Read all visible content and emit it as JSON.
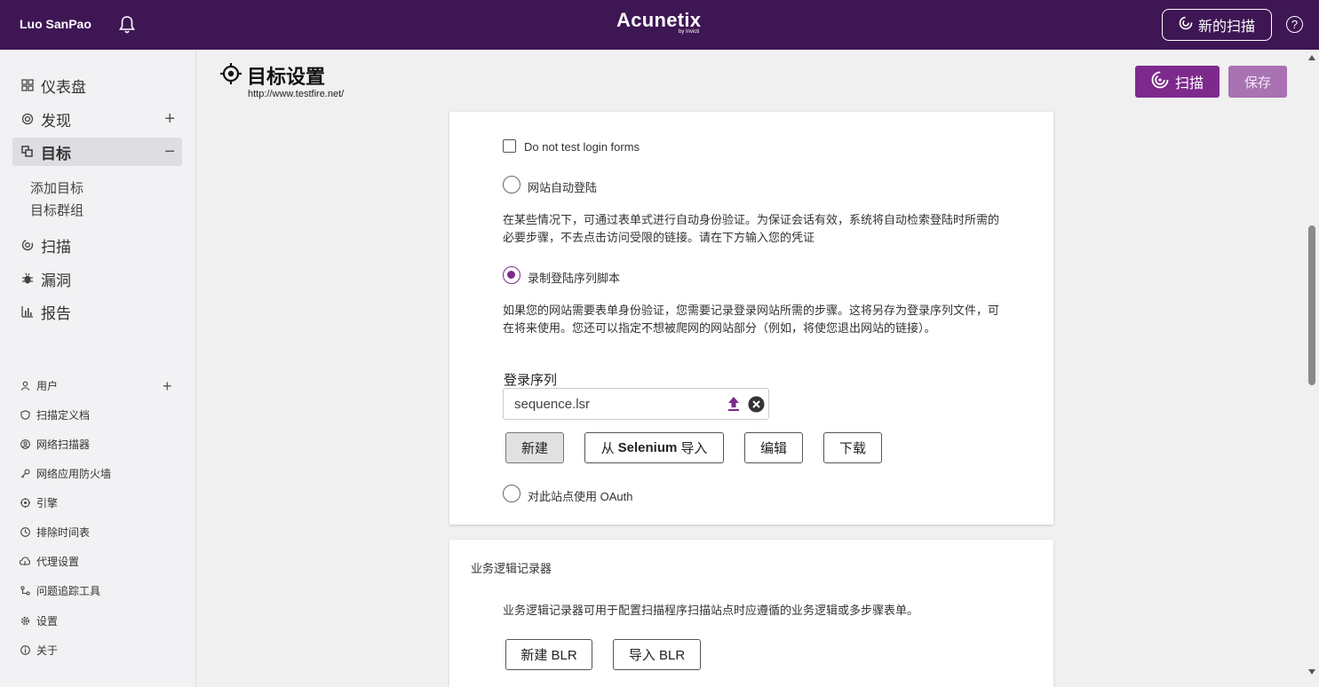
{
  "topbar": {
    "user_name": "Luo SanPao",
    "brand_name": "Acunetix",
    "brand_by": "by Invicti",
    "new_scan_label": "新的扫描",
    "help_label": "?"
  },
  "sidebar": {
    "nav": [
      {
        "label": "仪表盘",
        "icon": "dashboard-icon"
      },
      {
        "label": "发现",
        "icon": "discovery-icon",
        "expand": "+"
      },
      {
        "label": "目标",
        "icon": "targets-icon",
        "expand": "−",
        "active": true
      },
      {
        "label": "扫描",
        "icon": "scans-icon"
      },
      {
        "label": "漏洞",
        "icon": "bug-icon"
      },
      {
        "label": "报告",
        "icon": "reports-icon"
      }
    ],
    "target_sub": [
      "添加目标",
      "目标群组"
    ],
    "settings": [
      {
        "label": "用户",
        "icon": "user-icon"
      },
      {
        "label": "扫描定义档",
        "icon": "shield-icon"
      },
      {
        "label": "网络扫描器",
        "icon": "network-scanner-icon"
      },
      {
        "label": "网络应用防火墙",
        "icon": "key-icon"
      },
      {
        "label": "引擎",
        "icon": "engine-icon"
      },
      {
        "label": "排除时间表",
        "icon": "clock-icon"
      },
      {
        "label": "代理设置",
        "icon": "proxy-icon"
      },
      {
        "label": "问题追踪工具",
        "icon": "issue-tracker-icon"
      },
      {
        "label": "设置",
        "icon": "gear-icon"
      },
      {
        "label": "关于",
        "icon": "info-icon"
      }
    ],
    "users_add": "+"
  },
  "header": {
    "title": "目标设置",
    "url": "http://www.testfire.net/",
    "scan_label": "扫描",
    "save_label": "保存"
  },
  "login": {
    "no_test_label": "Do not test login forms",
    "no_test_checked": false,
    "auto_login_label": "网站自动登陆",
    "auto_login_desc": "在某些情况下，可通过表单式进行自动身份验证。为保证会话有效，系统将自动检索登陆时所需的必要步骤，不去点击访问受限的链接。请在下方输入您的凭证",
    "record_label": "录制登陆序列脚本",
    "record_selected": true,
    "record_desc": "如果您的网站需要表单身份验证，您需要记录登录网站所需的步骤。这将另存为登录序列文件，可在将来使用。您还可以指定不想被爬网的网站部分（例如，将使您退出网站的链接）。",
    "sequence_label": "登录序列",
    "sequence_value": "sequence.lsr",
    "btn_new": "新建",
    "btn_import_prefix": "从",
    "btn_import_bold": "Selenium",
    "btn_import_suffix": "导入",
    "btn_edit": "编辑",
    "btn_download": "下载",
    "oauth_label": "对此站点使用 OAuth"
  },
  "blr": {
    "title": "业务逻辑记录器",
    "desc": "业务逻辑记录器可用于配置扫描程序扫描站点时应遵循的业务逻辑或多步骤表单。",
    "btn_new": "新建 BLR",
    "btn_import": "导入 BLR"
  },
  "colors": {
    "topbar": "#3e1654",
    "accent": "#7d2a8c",
    "save_disabled": "#a872b3"
  }
}
